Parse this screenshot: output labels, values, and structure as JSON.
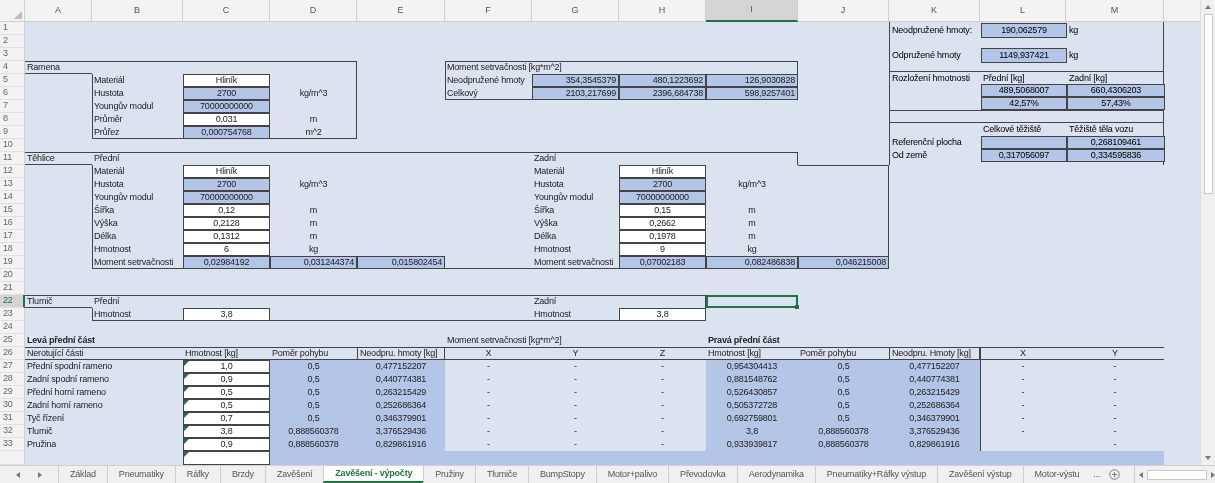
{
  "columns": [
    {
      "label": "A",
      "selected": false
    },
    {
      "label": "B",
      "selected": false
    },
    {
      "label": "C",
      "selected": false
    },
    {
      "label": "D",
      "selected": false
    },
    {
      "label": "E",
      "selected": false
    },
    {
      "label": "F",
      "selected": false
    },
    {
      "label": "G",
      "selected": false
    },
    {
      "label": "H",
      "selected": false
    },
    {
      "label": "I",
      "selected": true
    },
    {
      "label": "J",
      "selected": false
    },
    {
      "label": "K",
      "selected": false
    },
    {
      "label": "L",
      "selected": false
    },
    {
      "label": "M",
      "selected": false
    }
  ],
  "rows": [
    {
      "number": "1",
      "selected": false
    },
    {
      "number": "2",
      "selected": false
    },
    {
      "number": "3",
      "selected": false
    },
    {
      "number": "4",
      "selected": false,
      "cells": [
        {
          "kind": "text",
          "text": "Ramena"
        },
        {
          "kind": "empty"
        },
        {
          "kind": "empty"
        },
        {
          "kind": "empty"
        },
        {
          "kind": "empty"
        },
        {
          "kind": "text",
          "text": "Moment setrvačnosti [kg*m^2]"
        }
      ]
    },
    {
      "number": "5",
      "selected": false,
      "cells": [
        {
          "kind": "empty"
        },
        {
          "kind": "text",
          "text": "Materiál"
        },
        {
          "kind": "input",
          "text": "Hliník",
          "flagged": false
        },
        {
          "kind": "empty"
        },
        {
          "kind": "empty"
        },
        {
          "kind": "text",
          "text": "Neodpružené hmoty"
        },
        {
          "kind": "calc-right",
          "text": "354,3545379"
        },
        {
          "kind": "calc-right",
          "text": "480,1223692"
        },
        {
          "kind": "calc-right",
          "text": "126,9030828"
        }
      ]
    },
    {
      "number": "6",
      "selected": false,
      "cells": [
        {
          "kind": "empty"
        },
        {
          "kind": "text",
          "text": "Hustota"
        },
        {
          "kind": "calc",
          "text": "2700"
        },
        {
          "kind": "unit",
          "text": "kg/m^3"
        },
        {
          "kind": "empty"
        },
        {
          "kind": "text",
          "text": "Celkový"
        },
        {
          "kind": "calc-right",
          "text": "2103,217699"
        },
        {
          "kind": "calc-right",
          "text": "2396,684738"
        },
        {
          "kind": "calc-right",
          "text": "598,9257401"
        }
      ]
    },
    {
      "number": "7",
      "selected": false,
      "cells": [
        {
          "kind": "empty"
        },
        {
          "kind": "text",
          "text": "Youngův modul"
        },
        {
          "kind": "calc",
          "text": "70000000000"
        }
      ]
    },
    {
      "number": "8",
      "selected": false,
      "cells": [
        {
          "kind": "empty"
        },
        {
          "kind": "text",
          "text": "Průměr"
        },
        {
          "kind": "input",
          "text": "0,031",
          "flagged": false
        },
        {
          "kind": "unit",
          "text": "m"
        }
      ]
    },
    {
      "number": "9",
      "selected": false,
      "cells": [
        {
          "kind": "empty"
        },
        {
          "kind": "text",
          "text": "Průřez"
        },
        {
          "kind": "calc",
          "text": "0,000754768"
        },
        {
          "kind": "unit",
          "text": "m^2"
        }
      ]
    },
    {
      "number": "10",
      "selected": false
    },
    {
      "number": "11",
      "selected": false,
      "cells": [
        {
          "kind": "text",
          "text": "Těhlice"
        },
        {
          "kind": "text",
          "text": "Přední"
        },
        {
          "kind": "empty"
        },
        {
          "kind": "empty"
        },
        {
          "kind": "empty"
        },
        {
          "kind": "empty"
        },
        {
          "kind": "text",
          "text": "Zadní"
        }
      ]
    },
    {
      "number": "12",
      "selected": false,
      "cells": [
        {
          "kind": "empty"
        },
        {
          "kind": "text",
          "text": "Materiál"
        },
        {
          "kind": "input",
          "text": "Hliník",
          "flagged": false
        },
        {
          "kind": "empty"
        },
        {
          "kind": "empty"
        },
        {
          "kind": "empty"
        },
        {
          "kind": "text",
          "text": "Materiál"
        },
        {
          "kind": "input",
          "text": "Hliník",
          "flagged": false
        }
      ]
    },
    {
      "number": "13",
      "selected": false,
      "cells": [
        {
          "kind": "empty"
        },
        {
          "kind": "text",
          "text": "Hustota"
        },
        {
          "kind": "calc",
          "text": "2700"
        },
        {
          "kind": "unit",
          "text": "kg/m^3"
        },
        {
          "kind": "empty"
        },
        {
          "kind": "empty"
        },
        {
          "kind": "text",
          "text": "Hustota"
        },
        {
          "kind": "calc",
          "text": "2700"
        },
        {
          "kind": "unit",
          "text": "kg/m^3"
        }
      ]
    },
    {
      "number": "14",
      "selected": false,
      "cells": [
        {
          "kind": "empty"
        },
        {
          "kind": "text",
          "text": "Youngův modul"
        },
        {
          "kind": "calc",
          "text": "70000000000"
        },
        {
          "kind": "empty"
        },
        {
          "kind": "empty"
        },
        {
          "kind": "empty"
        },
        {
          "kind": "text",
          "text": "Youngův modul"
        },
        {
          "kind": "calc",
          "text": "70000000000"
        }
      ]
    },
    {
      "number": "15",
      "selected": false,
      "cells": [
        {
          "kind": "empty"
        },
        {
          "kind": "text",
          "text": "Šířka"
        },
        {
          "kind": "input",
          "text": "0,12",
          "flagged": false
        },
        {
          "kind": "unit",
          "text": "m"
        },
        {
          "kind": "empty"
        },
        {
          "kind": "empty"
        },
        {
          "kind": "text",
          "text": "Šířka"
        },
        {
          "kind": "input",
          "text": "0,15",
          "flagged": false
        },
        {
          "kind": "unit",
          "text": "m"
        }
      ]
    },
    {
      "number": "16",
      "selected": false,
      "cells": [
        {
          "kind": "empty"
        },
        {
          "kind": "text",
          "text": "Výška"
        },
        {
          "kind": "input",
          "text": "0,2128",
          "flagged": false
        },
        {
          "kind": "unit",
          "text": "m"
        },
        {
          "kind": "empty"
        },
        {
          "kind": "empty"
        },
        {
          "kind": "text",
          "text": "Výška"
        },
        {
          "kind": "input",
          "text": "0,2662",
          "flagged": false
        },
        {
          "kind": "unit",
          "text": "m"
        }
      ]
    },
    {
      "number": "17",
      "selected": false,
      "cells": [
        {
          "kind": "empty"
        },
        {
          "kind": "text",
          "text": "Délka"
        },
        {
          "kind": "input",
          "text": "0,1312",
          "flagged": false
        },
        {
          "kind": "unit",
          "text": "m"
        },
        {
          "kind": "empty"
        },
        {
          "kind": "empty"
        },
        {
          "kind": "text",
          "text": "Délka"
        },
        {
          "kind": "input",
          "text": "0,1978",
          "flagged": false
        },
        {
          "kind": "unit",
          "text": "m"
        }
      ]
    },
    {
      "number": "18",
      "selected": false,
      "cells": [
        {
          "kind": "empty"
        },
        {
          "kind": "text",
          "text": "Hmotnost"
        },
        {
          "kind": "input",
          "text": "6",
          "flagged": false
        },
        {
          "kind": "unit",
          "text": "kg"
        },
        {
          "kind": "empty"
        },
        {
          "kind": "empty"
        },
        {
          "kind": "text",
          "text": "Hmotnost"
        },
        {
          "kind": "input",
          "text": "9",
          "flagged": false
        },
        {
          "kind": "unit",
          "text": "kg"
        }
      ]
    },
    {
      "number": "19",
      "selected": false,
      "cells": [
        {
          "kind": "empty"
        },
        {
          "kind": "text",
          "text": "Moment setrvačnosti"
        },
        {
          "kind": "calc",
          "text": "0,02984192"
        },
        {
          "kind": "calc-right",
          "text": "0,031244374"
        },
        {
          "kind": "calc-right",
          "text": "0,015802454"
        },
        {
          "kind": "empty"
        },
        {
          "kind": "text",
          "text": "Moment setrvačnosti"
        },
        {
          "kind": "calc",
          "text": "0,07002183"
        },
        {
          "kind": "calc-right",
          "text": "0,082486838"
        },
        {
          "kind": "calc-right",
          "text": "0,046215008"
        }
      ]
    },
    {
      "number": "20",
      "selected": false
    },
    {
      "number": "21",
      "selected": false
    },
    {
      "number": "22",
      "selected": true,
      "cells": [
        {
          "kind": "text",
          "text": "Tlumič"
        },
        {
          "kind": "text",
          "text": "Přední"
        },
        {
          "kind": "empty"
        },
        {
          "kind": "empty"
        },
        {
          "kind": "empty"
        },
        {
          "kind": "empty"
        },
        {
          "kind": "text",
          "text": "Zadní"
        }
      ]
    },
    {
      "number": "23",
      "selected": false,
      "cells": [
        {
          "kind": "empty"
        },
        {
          "kind": "text",
          "text": "Hmotnost"
        },
        {
          "kind": "input",
          "text": "3,8",
          "flagged": false
        },
        {
          "kind": "empty"
        },
        {
          "kind": "empty"
        },
        {
          "kind": "empty"
        },
        {
          "kind": "text",
          "text": "Hmotnost"
        },
        {
          "kind": "input",
          "text": "3,8",
          "flagged": false
        }
      ]
    },
    {
      "number": "24",
      "selected": false
    },
    {
      "number": "25",
      "selected": false,
      "cells": [
        {
          "kind": "bold",
          "text": "Levá přední část"
        },
        {
          "kind": "empty"
        },
        {
          "kind": "empty"
        },
        {
          "kind": "empty"
        },
        {
          "kind": "empty"
        },
        {
          "kind": "text",
          "text": "Moment setrvačnosti [kg*m^2]"
        },
        {
          "kind": "empty"
        },
        {
          "kind": "empty"
        },
        {
          "kind": "bold",
          "text": "Pravá přední část"
        }
      ]
    },
    {
      "number": "26",
      "selected": false,
      "cells": [
        {
          "kind": "text",
          "text": "Nerotující části"
        },
        {
          "kind": "empty"
        },
        {
          "kind": "header",
          "text": "Hmotnost [kg]"
        },
        {
          "kind": "header",
          "text": "Poměr pohybu"
        },
        {
          "kind": "header-boxed",
          "text": "Neodpru. hmoty [kg]"
        },
        {
          "kind": "unit",
          "text": "X"
        },
        {
          "kind": "unit",
          "text": "Y"
        },
        {
          "kind": "unit",
          "text": "Z"
        },
        {
          "kind": "header",
          "text": "Hmotnost [kg]"
        },
        {
          "kind": "header",
          "text": "Poměr pohybu"
        },
        {
          "kind": "header-boxed",
          "text": "Neodpru. Hmoty [kg]"
        },
        {
          "kind": "unit",
          "text": "X"
        },
        {
          "kind": "unit",
          "text": "Y"
        }
      ]
    },
    {
      "number": "27",
      "selected": false,
      "cells": [
        {
          "kind": "text",
          "text": "Přední spodní rameno"
        },
        {
          "kind": "empty"
        },
        {
          "kind": "input",
          "text": "1,0",
          "flagged": true
        },
        {
          "kind": "fill",
          "text": "0,5"
        },
        {
          "kind": "fill",
          "text": "0,477152207"
        },
        {
          "kind": "unit",
          "text": "-"
        },
        {
          "kind": "unit",
          "text": "-"
        },
        {
          "kind": "unit",
          "text": "-"
        },
        {
          "kind": "fill",
          "text": "0,954304413"
        },
        {
          "kind": "fill",
          "text": "0,5"
        },
        {
          "kind": "fill",
          "text": "0,477152207"
        },
        {
          "kind": "unit",
          "text": "-"
        },
        {
          "kind": "unit",
          "text": "-"
        }
      ]
    },
    {
      "number": "28",
      "selected": false,
      "cells": [
        {
          "kind": "text",
          "text": "Zadní spodní rameno"
        },
        {
          "kind": "empty"
        },
        {
          "kind": "input",
          "text": "0,9",
          "flagged": true
        },
        {
          "kind": "fill",
          "text": "0,5"
        },
        {
          "kind": "fill",
          "text": "0,440774381"
        },
        {
          "kind": "unit",
          "text": "-"
        },
        {
          "kind": "unit",
          "text": "-"
        },
        {
          "kind": "unit",
          "text": "-"
        },
        {
          "kind": "fill",
          "text": "0,881548762"
        },
        {
          "kind": "fill",
          "text": "0,5"
        },
        {
          "kind": "fill",
          "text": "0,440774381"
        },
        {
          "kind": "unit",
          "text": "-"
        },
        {
          "kind": "unit",
          "text": "-"
        }
      ]
    },
    {
      "number": "29",
      "selected": false,
      "cells": [
        {
          "kind": "text",
          "text": "Přední horní rameno"
        },
        {
          "kind": "empty"
        },
        {
          "kind": "input",
          "text": "0,5",
          "flagged": true
        },
        {
          "kind": "fill",
          "text": "0,5"
        },
        {
          "kind": "fill",
          "text": "0,263215429"
        },
        {
          "kind": "unit",
          "text": "-"
        },
        {
          "kind": "unit",
          "text": "-"
        },
        {
          "kind": "unit",
          "text": "-"
        },
        {
          "kind": "fill",
          "text": "0,526430857"
        },
        {
          "kind": "fill",
          "text": "0,5"
        },
        {
          "kind": "fill",
          "text": "0,263215429"
        },
        {
          "kind": "unit",
          "text": "-"
        },
        {
          "kind": "unit",
          "text": "-"
        }
      ]
    },
    {
      "number": "30",
      "selected": false,
      "cells": [
        {
          "kind": "text",
          "text": "Zadní horní rameno"
        },
        {
          "kind": "empty"
        },
        {
          "kind": "input",
          "text": "0,5",
          "flagged": true
        },
        {
          "kind": "fill",
          "text": "0,5"
        },
        {
          "kind": "fill",
          "text": "0,252686364"
        },
        {
          "kind": "unit",
          "text": "-"
        },
        {
          "kind": "unit",
          "text": "-"
        },
        {
          "kind": "unit",
          "text": "-"
        },
        {
          "kind": "fill",
          "text": "0,505372728"
        },
        {
          "kind": "fill",
          "text": "0,5"
        },
        {
          "kind": "fill",
          "text": "0,252686364"
        },
        {
          "kind": "unit",
          "text": "-"
        },
        {
          "kind": "unit",
          "text": "-"
        }
      ]
    },
    {
      "number": "31",
      "selected": false,
      "cells": [
        {
          "kind": "text",
          "text": "Tyč řízení"
        },
        {
          "kind": "empty"
        },
        {
          "kind": "input",
          "text": "0,7",
          "flagged": true
        },
        {
          "kind": "fill",
          "text": "0,5"
        },
        {
          "kind": "fill",
          "text": "0,346379901"
        },
        {
          "kind": "unit",
          "text": "-"
        },
        {
          "kind": "unit",
          "text": "-"
        },
        {
          "kind": "unit",
          "text": "-"
        },
        {
          "kind": "fill",
          "text": "0,692759801"
        },
        {
          "kind": "fill",
          "text": "0,5"
        },
        {
          "kind": "fill",
          "text": "0,346379901"
        },
        {
          "kind": "unit",
          "text": "-"
        },
        {
          "kind": "unit",
          "text": "-"
        }
      ]
    },
    {
      "number": "32",
      "selected": false,
      "cells": [
        {
          "kind": "text",
          "text": "Tlumič"
        },
        {
          "kind": "empty"
        },
        {
          "kind": "input",
          "text": "3,8",
          "flagged": true
        },
        {
          "kind": "fill",
          "text": "0,888560378"
        },
        {
          "kind": "fill",
          "text": "3,376529436"
        },
        {
          "kind": "unit",
          "text": "-"
        },
        {
          "kind": "unit",
          "text": "-"
        },
        {
          "kind": "unit",
          "text": "-"
        },
        {
          "kind": "fill",
          "text": "3,8"
        },
        {
          "kind": "fill",
          "text": "0,888560378"
        },
        {
          "kind": "fill",
          "text": "3,376529436"
        },
        {
          "kind": "unit",
          "text": "-"
        },
        {
          "kind": "unit",
          "text": "-"
        }
      ]
    },
    {
      "number": "33",
      "selected": false,
      "cells": [
        {
          "kind": "text",
          "text": "Pružina"
        },
        {
          "kind": "empty"
        },
        {
          "kind": "input",
          "text": "0,9",
          "flagged": true
        },
        {
          "kind": "fill",
          "text": "0,888560378"
        },
        {
          "kind": "fill",
          "text": "0,829861916"
        },
        {
          "kind": "unit",
          "text": "-"
        },
        {
          "kind": "unit",
          "text": "-"
        },
        {
          "kind": "unit",
          "text": "-"
        },
        {
          "kind": "fill",
          "text": "0,933939817"
        },
        {
          "kind": "fill",
          "text": "0,888560378"
        },
        {
          "kind": "fill",
          "text": "0,829861916"
        },
        {
          "kind": "empty"
        },
        {
          "kind": "unit",
          "text": "-"
        }
      ]
    },
    {
      "selected": false,
      "cells": [
        {
          "kind": "empty"
        },
        {
          "kind": "empty"
        },
        {
          "kind": "input",
          "flagged": true
        },
        {
          "kind": "fill"
        },
        {
          "kind": "fill"
        },
        {
          "kind": "fill"
        },
        {
          "kind": "fill"
        },
        {
          "kind": "fill"
        },
        {
          "kind": "fill"
        },
        {
          "kind": "fill"
        },
        {
          "kind": "fill"
        },
        {
          "kind": "fill"
        },
        {
          "kind": "fill"
        }
      ]
    }
  ],
  "mass_panel": {
    "masses": [
      {
        "label": "Neodpružené hmoty:",
        "value": "190,062579",
        "unit": "kg"
      },
      {
        "label": "Odpružené hmoty",
        "value": "1149,937421",
        "unit": "kg"
      }
    ],
    "distribution": {
      "label": "Rozložení hmotnosti",
      "columns": [
        "Přední [kg]",
        "Zadní [kg]"
      ],
      "rows": [
        [
          "489,5068007",
          "660,4306203"
        ],
        [
          "42,57%",
          "57,43%"
        ]
      ]
    },
    "center_of_gravity": {
      "columns": [
        "Celkové těžiště",
        "Těžiště těla vozu"
      ],
      "rows": [
        {
          "label": "Referenční plocha",
          "values": [
            {
              "kind": "blank"
            },
            {
              "kind": "value",
              "text": "0,268109461"
            }
          ]
        },
        {
          "label": "Od země",
          "values": [
            {
              "kind": "value",
              "text": "0,317056097"
            },
            {
              "kind": "value",
              "text": "0,334595836"
            }
          ]
        }
      ]
    }
  },
  "sheet_tabs": [
    {
      "label": "Základ",
      "selected": false
    },
    {
      "label": "Pneumatiky",
      "selected": false
    },
    {
      "label": "Ráfky",
      "selected": false
    },
    {
      "label": "Brzdy",
      "selected": false
    },
    {
      "label": "Zavěšení",
      "selected": false
    },
    {
      "label": "Zavěšení - výpočty",
      "selected": true
    },
    {
      "label": "Pružiny",
      "selected": false
    },
    {
      "label": "Tlumiče",
      "selected": false
    },
    {
      "label": "BumpStopy",
      "selected": false
    },
    {
      "label": "Motor+palivo",
      "selected": false
    },
    {
      "label": "Převodovka",
      "selected": false
    },
    {
      "label": "Aerodynamika",
      "selected": false
    },
    {
      "label": "Pneumatiky+Ráfky výstup",
      "selected": false
    },
    {
      "label": "Zavěšení výstup",
      "selected": false
    },
    {
      "label": "Motor-výstu",
      "selected": false
    }
  ],
  "more_tabs": "..."
}
